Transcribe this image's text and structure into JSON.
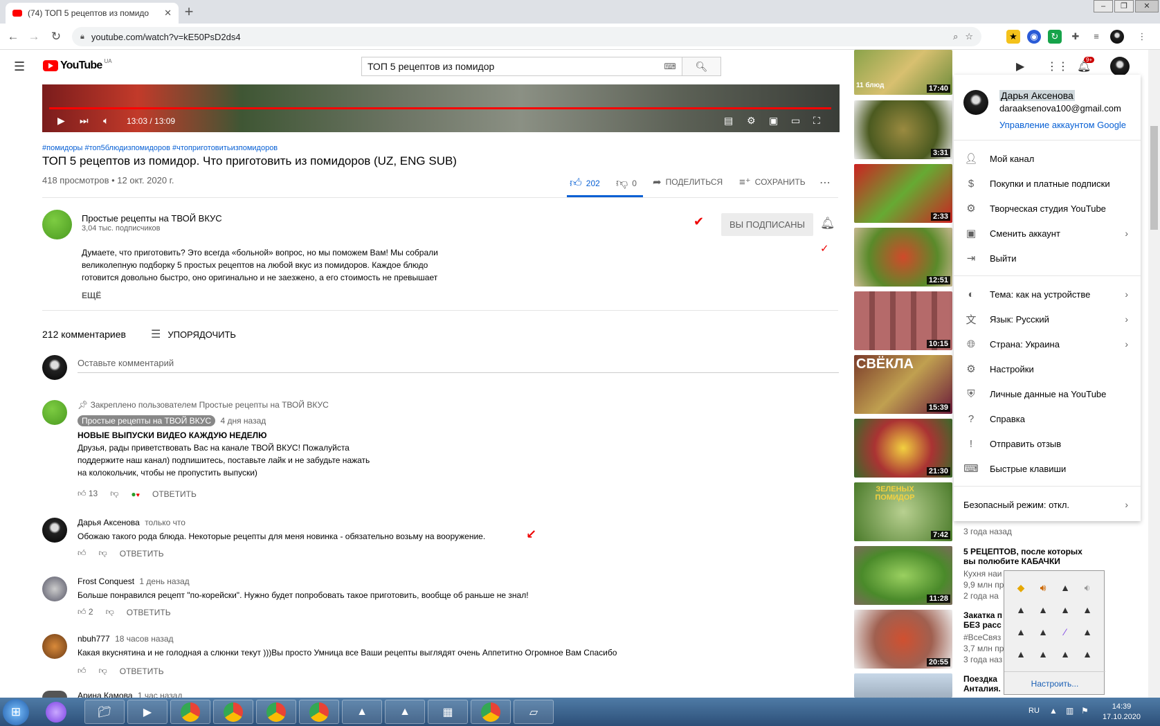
{
  "browser": {
    "tab_title": "(74) ТОП 5 рецептов из помидо",
    "url": "youtube.com/watch?v=kE50PsD2ds4"
  },
  "header": {
    "logo": "YouTube",
    "logo_region": "UA",
    "search_value": "ТОП 5 рецептов из помидор",
    "notif_badge": "9+"
  },
  "player": {
    "time": "13:03 / 13:09"
  },
  "video": {
    "hashtags": "#помидоры #топ5блюдизпомидоров #чтоприготовитьизпомидоров",
    "title": "ТОП 5 рецептов из помидор. Что приготовить из помидоров (UZ, ENG SUB)",
    "views": "418 просмотров • 12 окт. 2020 г.",
    "likes": "202",
    "dislikes": "0",
    "share": "ПОДЕЛИТЬСЯ",
    "save": "СОХРАНИТЬ"
  },
  "channel": {
    "name": "Простые рецепты на ТВОЙ ВКУС",
    "subs": "3,04 тыс. подписчиков",
    "subscribed": "ВЫ ПОДПИСАНЫ"
  },
  "description": {
    "line1": "Думаете, что приготовить?  Это всегда «больной» вопрос, но мы поможем Вам! Мы собрали",
    "line2": "великолепную подборку 5 простых рецептов на любой вкус из помидоров. Каждое блюдо",
    "line3": "готовится довольно быстро, оно оригинально и не заезжено, а его стоимость не превышает",
    "more": "ЕЩЁ"
  },
  "comments": {
    "count": "212 комментариев",
    "sort": "УПОРЯДОЧИТЬ",
    "add_placeholder": "Оставьте комментарий",
    "reply": "ОТВЕТИТЬ",
    "pinned": "Закреплено пользователем Простые рецепты на ТВОЙ ВКУС",
    "items": [
      {
        "author": "Простые рецепты на ТВОЙ ВКУС",
        "time": "4 дня назад",
        "l1": "НОВЫЕ ВЫПУСКИ ВИДЕО КАЖДУЮ НЕДЕЛЮ",
        "l2": "Друзья, рады приветствовать Вас на канале ТВОЙ ВКУС! Пожалуйста",
        "l3": "поддержите наш канал)  подпишитесь, поставьте лайк и не забудьте нажать",
        "l4": "на колокольчик, чтобы не пропустить выпуски)",
        "likes": "13"
      },
      {
        "author": "Дарья Аксенова",
        "time": "только что",
        "l1": "Обожаю такого рода блюда. Некоторые рецепты для меня новинка - обязательно возьму на вооружение."
      },
      {
        "author": "Frost Conquest",
        "time": "1 день назад",
        "l1": "Больше понравился рецепт \"по-корейски\". Нужно будет попробовать такое приготовить, вообще об раньше не знал!",
        "likes": "2"
      },
      {
        "author": "nbuh777",
        "time": "18 часов назад",
        "l1": "Какая вкуснятина и не голодная а слюнки текут )))Вы просто Умница все Ваши рецепты выглядят очень Аппетитно Огромное Вам Спасибо"
      },
      {
        "author": "Арина Камова",
        "time": "1 час назад"
      }
    ]
  },
  "sidebar": {
    "durations": [
      "17:40",
      "3:31",
      "2:33",
      "12:51",
      "10:15",
      "15:39",
      "21:30",
      "7:42",
      "11:28",
      "20:55",
      ""
    ],
    "top_thumb_text": "11 блюд",
    "thumb_text_6": "СВЁКЛА",
    "thumb_text_8": "ЗЕЛЕНЫХ ПОМИДОР",
    "item8_meta": "3 года назад",
    "item9_title1": "5 РЕЦЕПТОВ, после которых",
    "item9_title2": "вы полюбите КАБАЧКИ",
    "item9_ch": "Кухня наи",
    "item9_views": "9,9 млн пр",
    "item9_age": "2 года на",
    "item10_t1": "Закатка п",
    "item10_t2": "БЕЗ расс",
    "item10_ch": "#ВсеСвяз",
    "item10_views": "3,7 млн пр",
    "item10_age": "3 года наз",
    "item11_t1": "Поездка",
    "item11_t2": "Анталия."
  },
  "account_menu": {
    "name": "Дарья Аксенова",
    "email": "daraaksenova100@gmail.com",
    "manage": "Управление аккаунтом Google",
    "items": [
      "Мой канал",
      "Покупки и платные подписки",
      "Творческая студия YouTube",
      "Сменить аккаунт",
      "Выйти",
      "Тема: как на устройстве",
      "Язык: Русский",
      "Страна: Украина",
      "Настройки",
      "Личные данные на YouTube",
      "Справка",
      "Отправить отзыв",
      "Быстрые клавиши"
    ],
    "safe_mode": "Безопасный режим: откл."
  },
  "tray": {
    "customize": "Настроить..."
  },
  "taskbar": {
    "lang": "RU",
    "time": "14:39",
    "date": "17.10.2020"
  }
}
